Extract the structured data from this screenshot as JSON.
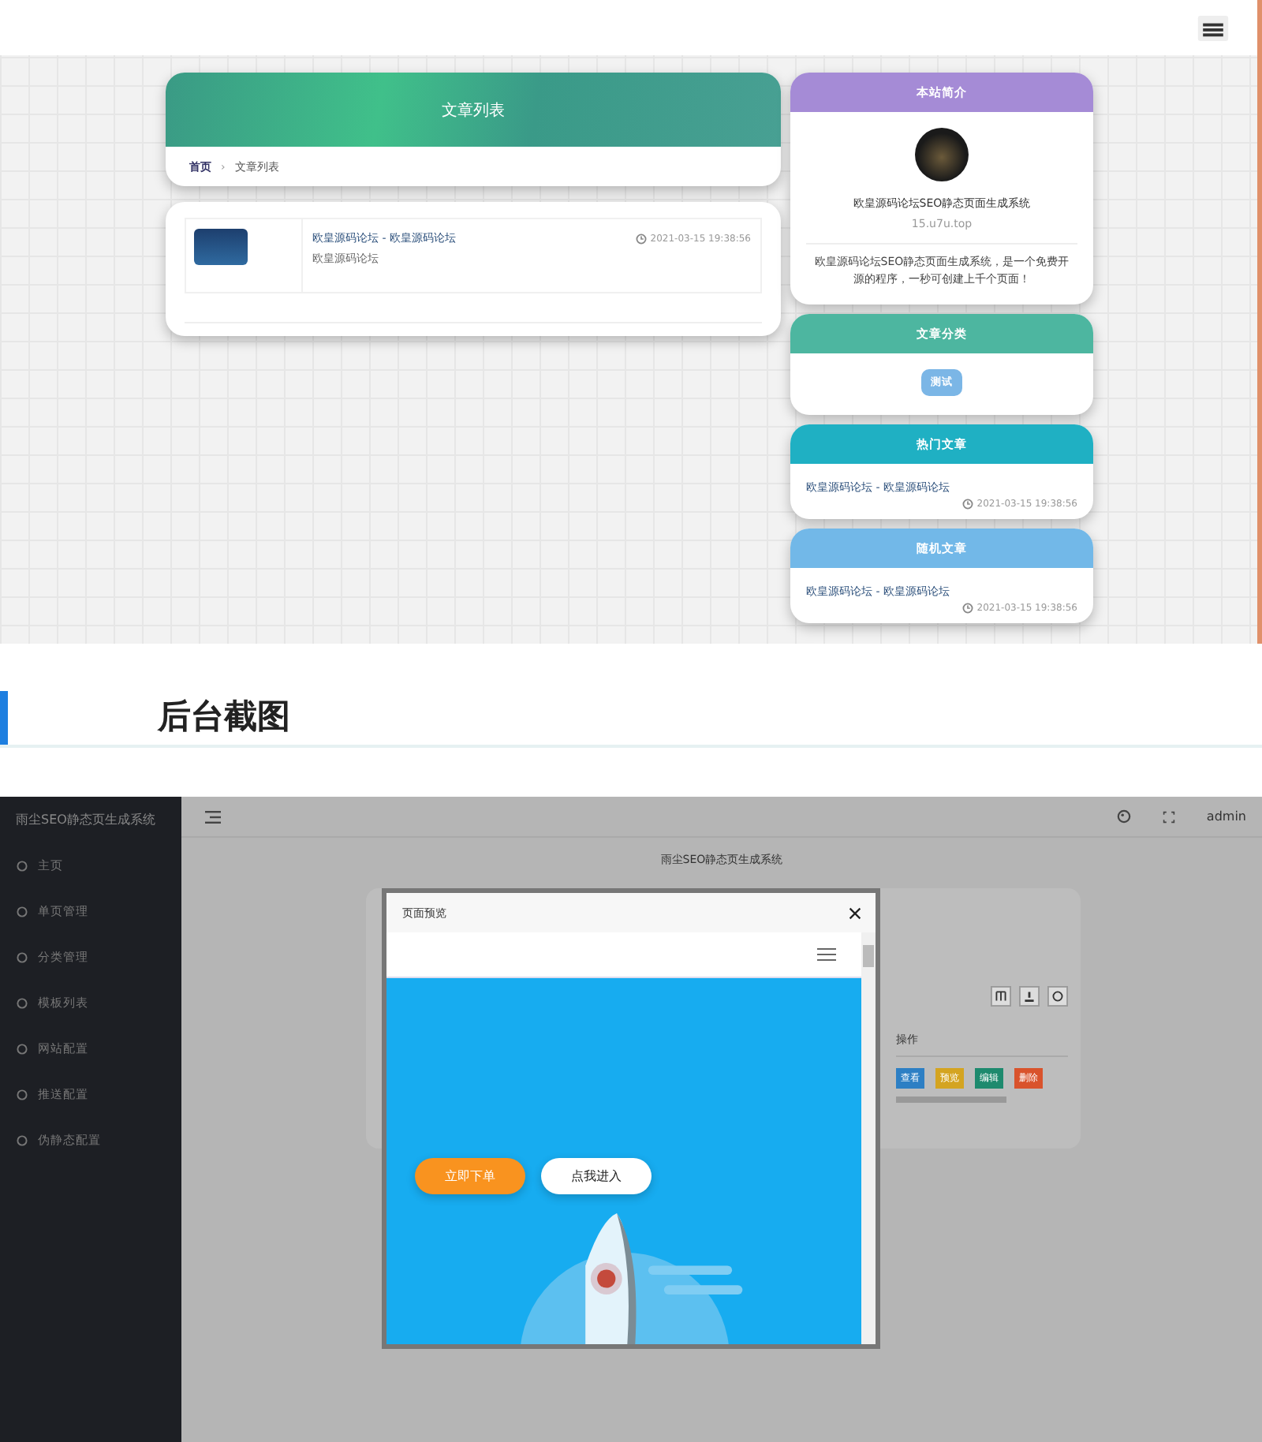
{
  "page_header": {
    "title": "文章列表",
    "breadcrumb": [
      "首页",
      "文章列表"
    ],
    "separator": "›"
  },
  "articles": [
    {
      "title": "欧皇源码论坛 - 欧皇源码论坛",
      "excerpt": "欧皇源码论坛",
      "time": "2021-03-15 19:38:56"
    }
  ],
  "widgets": [
    {
      "kind": "intro",
      "title": "本站简介",
      "color": "#a58bd6",
      "site_name": "欧皇源码论坛SEO静态页面生成系统",
      "url": "15.u7u.top",
      "description": "欧皇源码论坛SEO静态页面生成系统，是一个免费开源的程序，一秒可创建上千个页面！"
    },
    {
      "kind": "tags",
      "title": "文章分类",
      "color": "#4db6a0",
      "tags": [
        "测试"
      ]
    },
    {
      "kind": "posts",
      "title": "热门文章",
      "color": "#1fb0c3",
      "posts": [
        {
          "title": "欧皇源码论坛 - 欧皇源码论坛",
          "time": "2021-03-15 19:38:56"
        }
      ]
    },
    {
      "kind": "posts",
      "title": "随机文章",
      "color": "#72b8e8",
      "posts": [
        {
          "title": "欧皇源码论坛 - 欧皇源码论坛",
          "time": "2021-03-15 19:38:56"
        }
      ]
    }
  ],
  "section_heading": "后台截图",
  "admin": {
    "brand": "雨尘SEO静态页生成系统",
    "menu": [
      "主页",
      "单页管理",
      "分类管理",
      "模板列表",
      "网站配置",
      "推送配置",
      "伪静态配置"
    ],
    "user": "admin",
    "subtitle": "雨尘SEO静态页生成系统",
    "table": {
      "header": "操作",
      "actions": [
        {
          "label": "查看",
          "color": "#2d7fc4"
        },
        {
          "label": "预览",
          "color": "#d4a421"
        },
        {
          "label": "编辑",
          "color": "#1e8a6e"
        },
        {
          "label": "删除",
          "color": "#d9532c"
        }
      ]
    },
    "modal": {
      "title": "页面预览",
      "buttons": [
        {
          "label": "立即下单",
          "kind": "primary"
        },
        {
          "label": "点我进入",
          "kind": "secondary"
        }
      ]
    }
  }
}
